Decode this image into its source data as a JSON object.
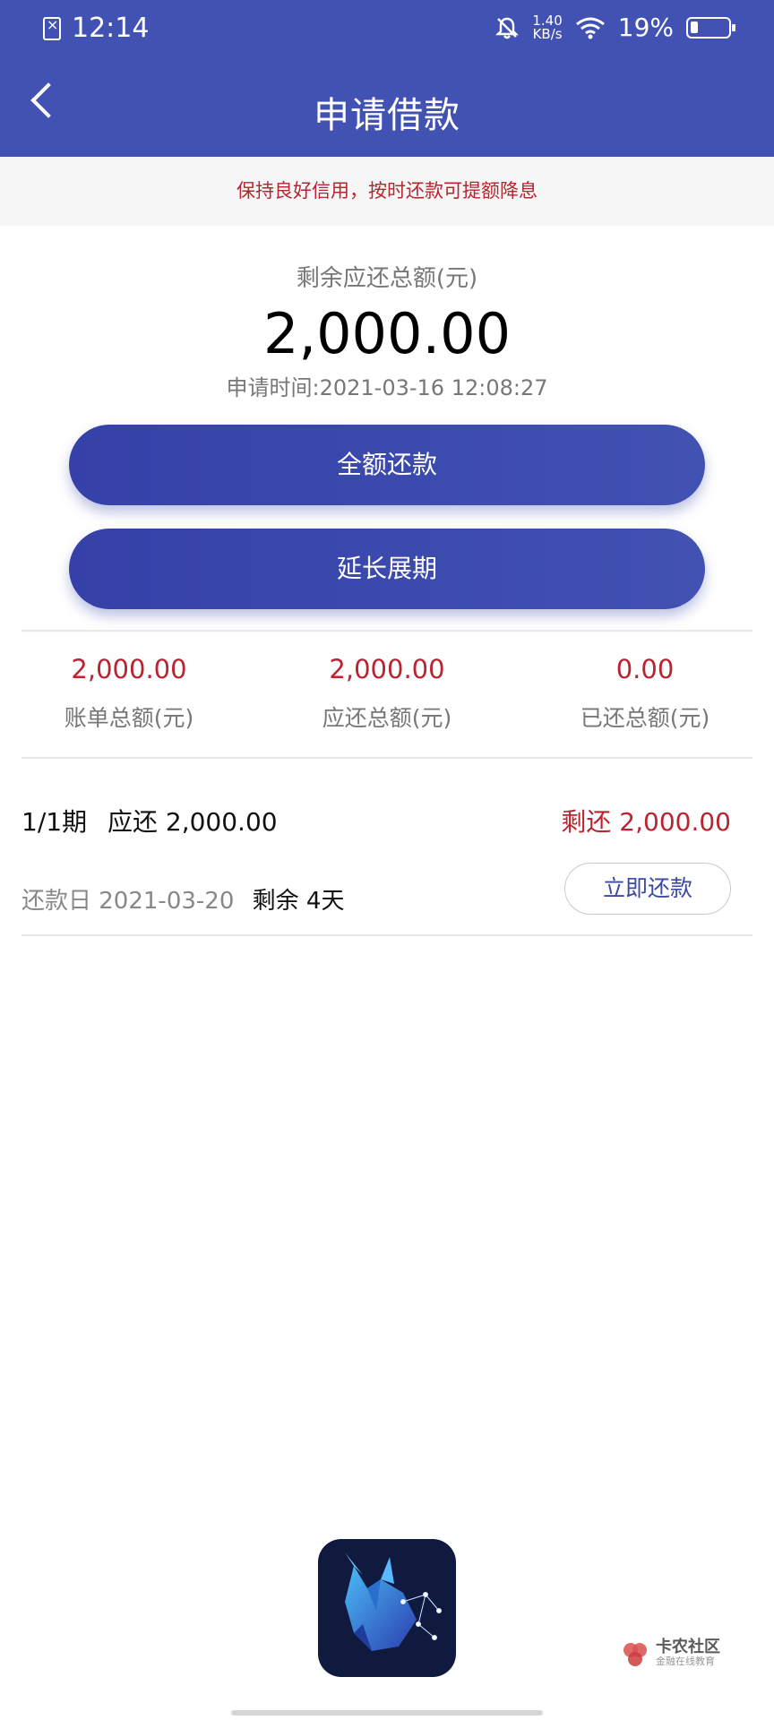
{
  "status_bar": {
    "time": "12:14",
    "net_speed_value": "1.40",
    "net_speed_unit": "KB/s",
    "battery": "19%"
  },
  "header": {
    "title": "申请借款"
  },
  "notice": "保持良好信用，按时还款可提额降息",
  "summary": {
    "label": "剩余应还总额(元)",
    "amount": "2,000.00",
    "apply_time": "申请时间:2021-03-16 12:08:27"
  },
  "buttons": {
    "full_repay": "全额还款",
    "extend": "延长展期"
  },
  "stats": [
    {
      "value": "2,000.00",
      "label": "账单总额(元)"
    },
    {
      "value": "2,000.00",
      "label": "应还总额(元)"
    },
    {
      "value": "0.00",
      "label": "已还总额(元)"
    }
  ],
  "installment": {
    "period": "1/1期",
    "due_label": "应还 2,000.00",
    "remaining": "剩还 2,000.00",
    "repay_date": "还款日 2021-03-20",
    "days_left": "剩余 4天",
    "pay_now": "立即还款"
  },
  "brand": {
    "name": "卡农社区",
    "sub": "金融在线教育"
  },
  "colors": {
    "primary": "#4252b3",
    "accent_red": "#b8242f"
  }
}
